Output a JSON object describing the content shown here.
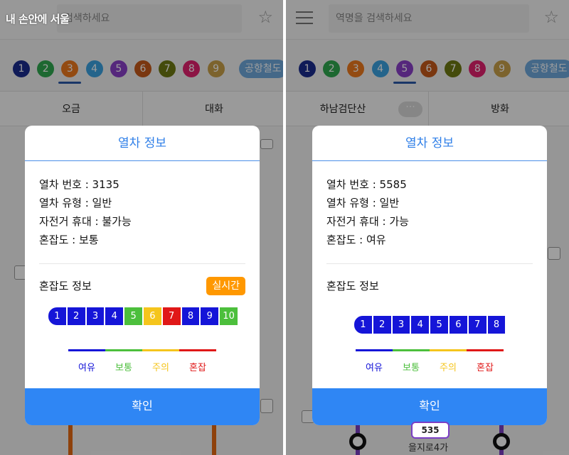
{
  "watermark": "내 손안에 서울",
  "icons": {
    "star": "star-outline-icon",
    "menu": "hamburger-menu-icon"
  },
  "left": {
    "search_placeholder": "검색하세요",
    "lines": [
      {
        "label": "1",
        "color": "#1b2d8f"
      },
      {
        "label": "2",
        "color": "#2fa84f"
      },
      {
        "label": "3",
        "color": "#ee7a1e"
      },
      {
        "label": "4",
        "color": "#3aa2e0"
      },
      {
        "label": "5",
        "color": "#8a3fc9"
      },
      {
        "label": "6",
        "color": "#c55a1a"
      },
      {
        "label": "7",
        "color": "#6f7a12"
      },
      {
        "label": "8",
        "color": "#e3216f"
      },
      {
        "label": "9",
        "color": "#c9a04a"
      }
    ],
    "airport": "공항철도",
    "selected_line_color": "#ee7a1e",
    "station_left": "오금",
    "station_right": "대화",
    "dialog": {
      "title": "열차 정보",
      "train_no": "열차 번호 : 3135",
      "train_type": "열차 유형 : 일반",
      "bike": "자전거 휴대 : 불가능",
      "congestion": "혼잡도 : 보통",
      "congestion_info": "혼잡도 정보",
      "realtime": "실시간",
      "cars": [
        {
          "label": "1",
          "color": "#1515d8"
        },
        {
          "label": "2",
          "color": "#1515d8"
        },
        {
          "label": "3",
          "color": "#1515d8"
        },
        {
          "label": "4",
          "color": "#1515d8"
        },
        {
          "label": "5",
          "color": "#4cbf3c"
        },
        {
          "label": "6",
          "color": "#f5c51c"
        },
        {
          "label": "7",
          "color": "#e01818"
        },
        {
          "label": "8",
          "color": "#1515d8"
        },
        {
          "label": "9",
          "color": "#1515d8"
        },
        {
          "label": "10",
          "color": "#4cbf3c"
        }
      ],
      "confirm": "확인"
    }
  },
  "right": {
    "search_placeholder": "역명을 검색하세요",
    "lines": [
      {
        "label": "1",
        "color": "#1b2d8f"
      },
      {
        "label": "2",
        "color": "#2fa84f"
      },
      {
        "label": "3",
        "color": "#ee7a1e"
      },
      {
        "label": "4",
        "color": "#3aa2e0"
      },
      {
        "label": "5",
        "color": "#8a3fc9"
      },
      {
        "label": "6",
        "color": "#c55a1a"
      },
      {
        "label": "7",
        "color": "#6f7a12"
      },
      {
        "label": "8",
        "color": "#e3216f"
      },
      {
        "label": "9",
        "color": "#c9a04a"
      }
    ],
    "airport": "공항철도",
    "selected_line_color": "#8a3fc9",
    "station_left": "하남검단산",
    "more": "···",
    "station_right": "방화",
    "dialog": {
      "title": "열차 정보",
      "train_no": "열차 번호 : 5585",
      "train_type": "열차 유형 : 일반",
      "bike": "자전거 휴대 : 가능",
      "congestion": "혼잡도 : 여유",
      "congestion_info": "혼잡도 정보",
      "cars": [
        {
          "label": "1",
          "color": "#1515d8"
        },
        {
          "label": "2",
          "color": "#1515d8"
        },
        {
          "label": "3",
          "color": "#1515d8"
        },
        {
          "label": "4",
          "color": "#1515d8"
        },
        {
          "label": "5",
          "color": "#1515d8"
        },
        {
          "label": "6",
          "color": "#1515d8"
        },
        {
          "label": "7",
          "color": "#1515d8"
        },
        {
          "label": "8",
          "color": "#1515d8"
        }
      ],
      "confirm": "확인"
    },
    "station_badge": "535",
    "station_name": "을지로4가"
  },
  "legend": [
    {
      "label": "여유",
      "color": "#1515d8"
    },
    {
      "label": "보통",
      "color": "#4cbf3c"
    },
    {
      "label": "주의",
      "color": "#f5c51c"
    },
    {
      "label": "혼잡",
      "color": "#e01818"
    }
  ]
}
